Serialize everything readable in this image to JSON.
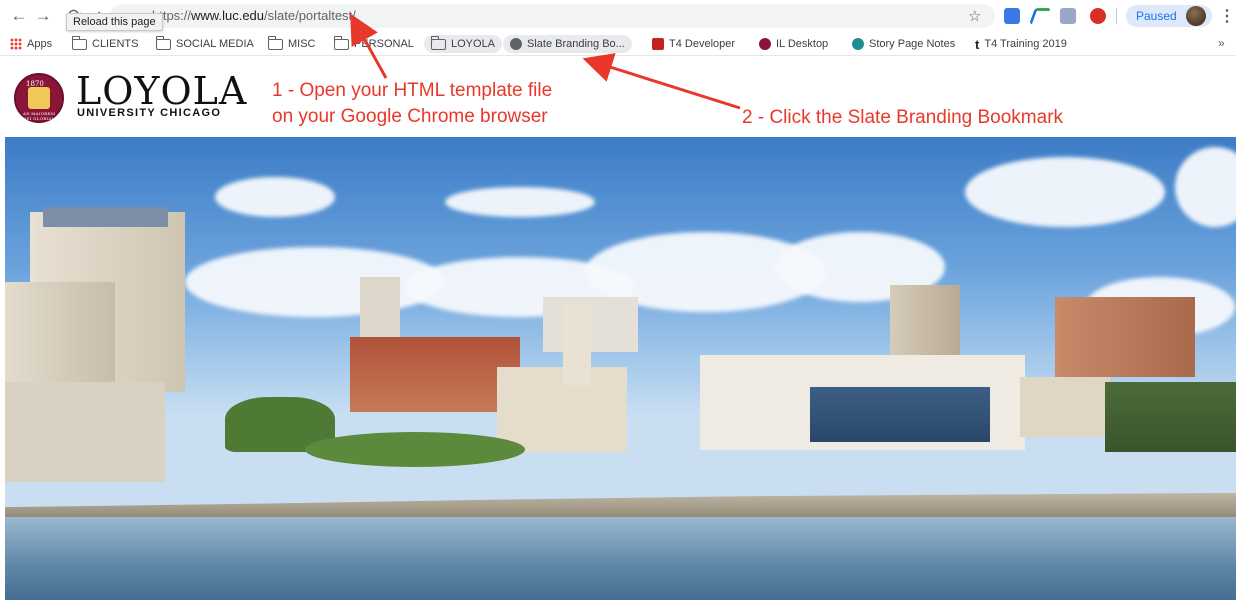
{
  "browser": {
    "url_prefix": "https://",
    "url_host": "www.luc.edu",
    "url_path": "/slate/portaltest/",
    "tooltip": "Reload this page",
    "profile_status": "Paused",
    "icons": {
      "back": "←",
      "forward": "→",
      "reload": "⟳",
      "home": "⌂",
      "star": "☆",
      "menu": "⋮",
      "more_bookmarks": "»"
    }
  },
  "bookmarks": [
    {
      "label": "Apps",
      "icon": "apps-icon"
    },
    {
      "label": "CLIENTS",
      "icon": "folder-icon"
    },
    {
      "label": "SOCIAL MEDIA",
      "icon": "folder-icon"
    },
    {
      "label": "MISC",
      "icon": "folder-icon"
    },
    {
      "label": "PERSONAL",
      "icon": "folder-icon"
    },
    {
      "label": "LOYOLA",
      "icon": "folder-icon"
    },
    {
      "label": "Slate Branding Bo...",
      "icon": "globe-icon"
    },
    {
      "label": "T4 Developer",
      "icon": "t4-icon"
    },
    {
      "label": "IL Desktop",
      "icon": "il-icon"
    },
    {
      "label": "Story Page Notes",
      "icon": "notes-icon"
    },
    {
      "label": "T4 Training 2019",
      "icon": "t-icon"
    }
  ],
  "header": {
    "wordmark": "LOYOLA",
    "sub_wordmark": "UNIVERSITY CHICAGO",
    "seal_year": "1870",
    "seal_motto": "AD MAIOREM DEI GLORIAM"
  },
  "annotations": {
    "step1_line1": "1 - Open your HTML template file",
    "step1_line2": "on your Google Chrome browser",
    "step2": "2 - Click the Slate Branding Bookmark"
  },
  "colors": {
    "annotation": "#e8382b",
    "loyola_maroon": "#8a1538",
    "loyola_gold": "#f0c85a",
    "chrome_accent": "#1a73e8"
  }
}
